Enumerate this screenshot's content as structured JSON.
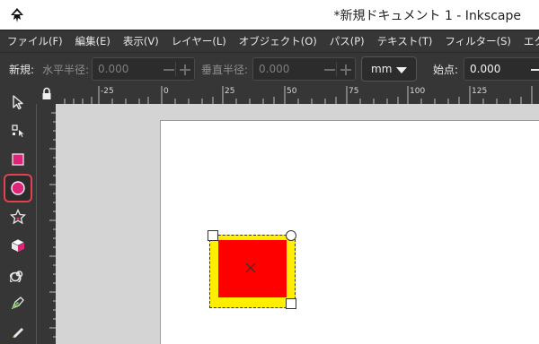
{
  "window": {
    "title": "*新規ドキュメント 1 - Inkscape",
    "app_icon": "inkscape-logo-icon"
  },
  "menu": [
    {
      "label": "ファイル(F)"
    },
    {
      "label": "編集(E)"
    },
    {
      "label": "表示(V)"
    },
    {
      "label": "レイヤー(L)"
    },
    {
      "label": "オブジェクト(O)"
    },
    {
      "label": "パス(P)"
    },
    {
      "label": "テキスト(T)"
    },
    {
      "label": "フィルター(S)"
    },
    {
      "label": "エクステンション"
    }
  ],
  "controls": {
    "new_label": "新規:",
    "rx_label": "水平半径:",
    "rx_value": "0.000",
    "ry_label": "垂直半径:",
    "ry_value": "0.000",
    "unit": "mm",
    "start_label": "始点:",
    "start_value": "0.000"
  },
  "rulers": {
    "top_labels": [
      "-25",
      "0",
      "25",
      "50",
      "75",
      "100",
      "125"
    ]
  },
  "tools": [
    {
      "name": "selector-tool-icon",
      "active": false
    },
    {
      "name": "node-tool-icon",
      "active": false
    },
    {
      "name": "rectangle-tool-icon",
      "active": false
    },
    {
      "name": "ellipse-tool-icon",
      "active": true
    },
    {
      "name": "star-tool-icon",
      "active": false
    },
    {
      "name": "3d-box-tool-icon",
      "active": false
    },
    {
      "name": "spiral-tool-icon",
      "active": false
    },
    {
      "name": "pen-tool-icon",
      "active": false
    },
    {
      "name": "pencil-tool-icon",
      "active": false
    }
  ],
  "colors": {
    "object_fill": "#ff0000",
    "object_stroke": "#ffee00",
    "active_tool_border": "#e2414f",
    "tool_accent": "#e0247a"
  }
}
